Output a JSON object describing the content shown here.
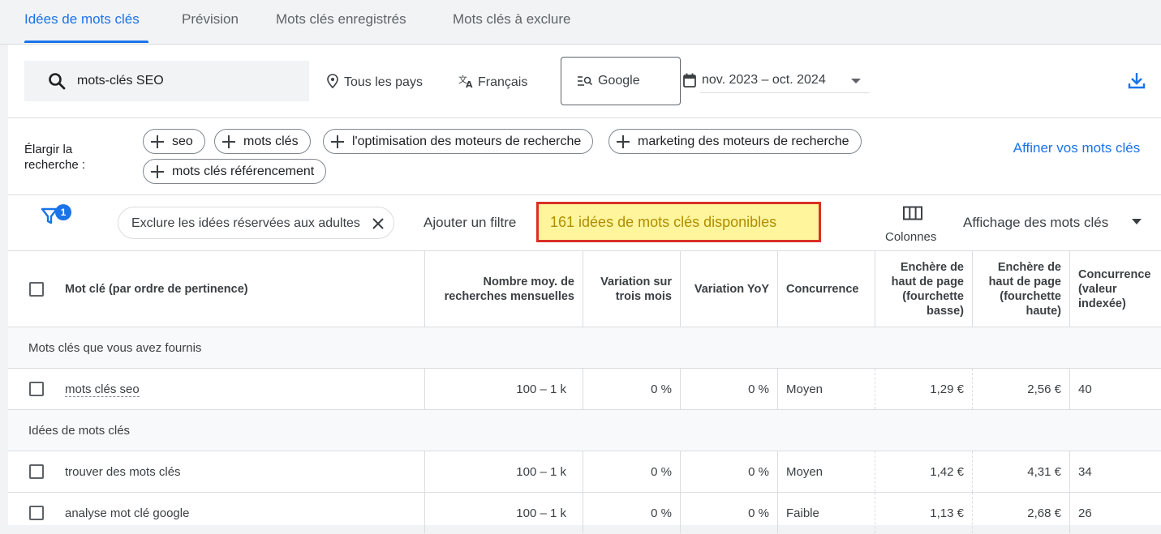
{
  "tabs": [
    "Idées de mots clés",
    "Prévision",
    "Mots clés enregistrés",
    "Mots clés à exclure"
  ],
  "search": {
    "value": "mots-clés SEO"
  },
  "location": "Tous les pays",
  "language": "Français",
  "network": "Google",
  "date_range": "nov. 2023 – oct. 2024",
  "widen": {
    "label": "Élargir la recherche :",
    "chips": [
      "seo",
      "mots clés",
      "l'optimisation des moteurs de recherche",
      "marketing des moteurs de recherche",
      "mots clés référencement"
    ]
  },
  "refine_label": "Affiner vos mots clés",
  "filter_badge": "1",
  "exclude_chip": "Exclure les idées réservées aux adultes",
  "add_filter": "Ajouter un filtre",
  "ideas_count": "161 idées de mots clés disponibles",
  "columns_label": "Colonnes",
  "view_label": "Affichage des mots clés",
  "table": {
    "headers": [
      "Mot clé (par ordre de pertinence)",
      "Nombre moy. de recherches mensuelles",
      "Variation sur trois mois",
      "Variation YoY",
      "Concurrence",
      "Enchère de haut de page (fourchette basse)",
      "Enchère de haut de page (fourchette haute)",
      "Concurrence (valeur indexée)"
    ],
    "group1": "Mots clés que vous avez fournis",
    "group2": "Idées de mots clés",
    "rows": [
      [
        "mots clés seo",
        "100 – 1 k",
        "0 %",
        "0 %",
        "Moyen",
        "1,29 €",
        "2,56 €",
        "40"
      ],
      [
        "trouver des mots clés",
        "100 – 1 k",
        "0 %",
        "0 %",
        "Moyen",
        "1,42 €",
        "4,31 €",
        "34"
      ],
      [
        "analyse mot clé google",
        "100 – 1 k",
        "0 %",
        "0 %",
        "Faible",
        "1,13 €",
        "2,68 €",
        "26"
      ]
    ]
  },
  "colors": {
    "accent": "#1a73e8",
    "highlight_bg": "#fff59d",
    "highlight_border": "#d93025"
  }
}
